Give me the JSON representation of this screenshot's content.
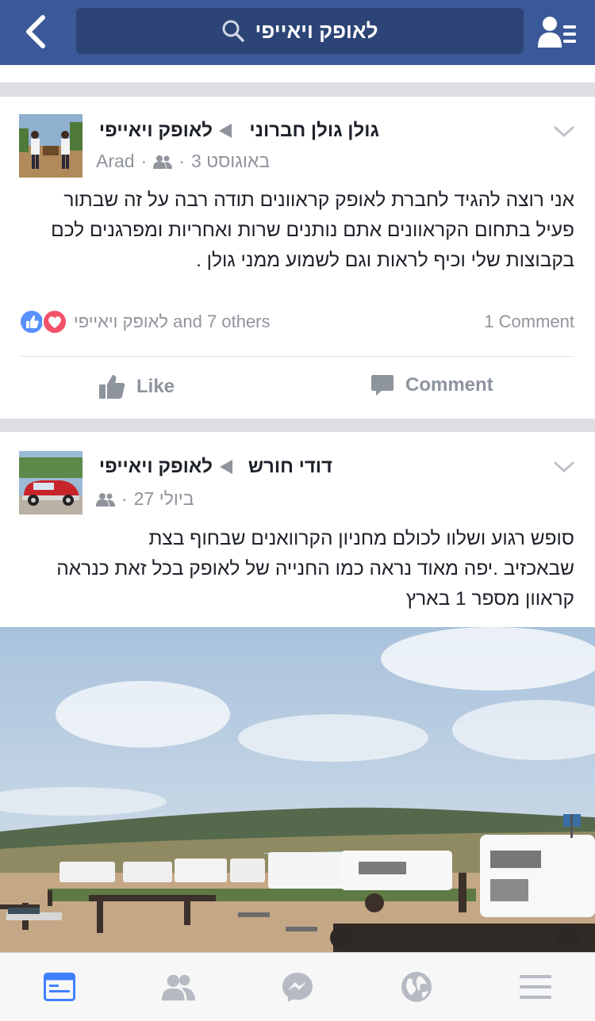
{
  "topbar": {
    "search_text": "לאופק ויאייפי",
    "back_icon": "chevron-left-icon",
    "friends_icon": "friend-requests-icon",
    "color": "#3b5998"
  },
  "posts": [
    {
      "author": "גולן גולן חברוני",
      "target": "לאופק ויאייפי",
      "date": "3 באוגוסט",
      "location": "Arad",
      "text_lines": [
        "אני רוצה להגיד לחברת לאופק קראוונים תודה רבה על זה שבתור",
        "פעיל בתחום הקראוונים אתם נותנים שרות ואחריות ומפרגנים לכם",
        "בקבוצות שלי וכיף לראות וגם לשמוע ממני גולן ."
      ],
      "reactions_text": "לאופק ויאייפי and 7 others",
      "comments": "1 Comment",
      "like_label": "Like",
      "comment_label": "Comment"
    },
    {
      "author": "דודי חורש",
      "target": "לאופק ויאייפי",
      "date": "27 ביולי",
      "text_lines": [
        "סופש רגוע ושלוו לכולם מחניון הקרוואנים שבחוף בצת",
        "שבאכזיב .יפה מאוד נראה כמו החנייה של לאופק בכל זאת כנראה",
        "קראוון מספר 1 בארץ"
      ]
    }
  ],
  "bottom_nav": [
    {
      "icon": "news-feed-icon",
      "active": true
    },
    {
      "icon": "friends-icon",
      "active": false
    },
    {
      "icon": "messenger-icon",
      "active": false
    },
    {
      "icon": "notifications-globe-icon",
      "active": false
    },
    {
      "icon": "menu-icon",
      "active": false
    }
  ],
  "colors": {
    "accent": "#3b5998",
    "active_tab": "#4080ff",
    "like_blue": "#5890ff",
    "love_red": "#f25268"
  }
}
